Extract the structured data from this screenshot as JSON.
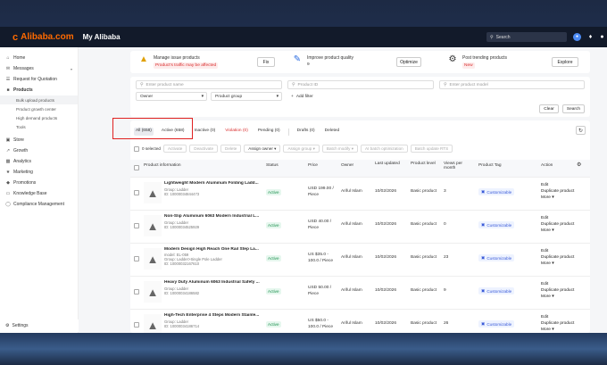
{
  "topbar": {
    "logo_text": "Alibaba.com",
    "section": "My Alibaba",
    "search_placeholder": "Search"
  },
  "sidebar": {
    "items": [
      {
        "label": "Home"
      },
      {
        "label": "Messages"
      },
      {
        "label": "Request for Quotation"
      },
      {
        "label": "Products"
      },
      {
        "label": "Store"
      },
      {
        "label": "Growth"
      },
      {
        "label": "Analytics"
      },
      {
        "label": "Marketing"
      },
      {
        "label": "Promotions"
      },
      {
        "label": "Knowledge Base"
      },
      {
        "label": "Compliance Management"
      }
    ],
    "products_sub": [
      "Bulk upload products",
      "Product growth center",
      "High demand products",
      "Tools"
    ],
    "settings": "Settings"
  },
  "tasks": [
    {
      "title": "Manage issue products",
      "sub": "Product's traffic may be affected",
      "button": "Fix"
    },
    {
      "title": "Improve product quality",
      "sub": "9",
      "button": "Optimize"
    },
    {
      "title": "Post trending products",
      "sub": "New",
      "button": "Explore"
    }
  ],
  "filters": {
    "product_name_placeholder": "Enter product name",
    "product_id_placeholder": "Product ID",
    "product_model_placeholder": "Enter product model",
    "owner": "Owner",
    "product_group": "Product group",
    "add_filter": "Add filter",
    "clear": "Clear",
    "search": "Search"
  },
  "tabs": [
    {
      "label": "All",
      "count": "(658)"
    },
    {
      "label": "Active",
      "count": "(658)"
    },
    {
      "label": "Inactive",
      "count": "(0)"
    },
    {
      "label": "Violation",
      "count": "(0)"
    },
    {
      "label": "Pending",
      "count": "(0)"
    },
    {
      "label": "Drafts",
      "count": "(0)"
    },
    {
      "label": "Deleted",
      "count": ""
    }
  ],
  "bulk": {
    "selected": "0 selected",
    "buttons": [
      "Activate",
      "Deactivate",
      "Delete",
      "Assign owner",
      "Assign group",
      "Batch modify",
      "AI batch optimization",
      "Batch update RTS"
    ]
  },
  "table": {
    "headers": [
      "Product information",
      "Status",
      "Price",
      "Owner",
      "Last updated",
      "Product level",
      "Views per month",
      "Product Tag",
      "Action"
    ],
    "rows": [
      {
        "name": "Lightweight Modern Aluminum Folding Ladd...",
        "meta1": "Group: Ladder",
        "meta2": "ID: 10000034844473",
        "status": "Active",
        "price1": "USD 199.00 /",
        "price2": "Piece",
        "owner": "Ariful Islam",
        "date": "10/02/2026",
        "level": "Basic product",
        "views": "3",
        "tag": "Customizable",
        "actions": [
          "Edit",
          "Duplicate product",
          "More"
        ]
      },
      {
        "name": "Non-Slip Aluminum 6063 Modern Industrial L...",
        "meta1": "Group: Ladder",
        "meta2": "ID: 10000034525929",
        "status": "Active",
        "price1": "USD 40.00 /",
        "price2": "Piece",
        "owner": "Ariful Islam",
        "date": "10/02/2026",
        "level": "Basic product",
        "views": "0",
        "tag": "Customizable",
        "actions": [
          "Edit",
          "Duplicate product",
          "More"
        ]
      },
      {
        "name": "Modern Design High Reach One Rail Step La...",
        "meta1": "model: EL-059",
        "meta2": "Group: Ladder>Single Pole Ladder",
        "meta3": "ID: 10000032167610",
        "status": "Active",
        "price1": "US $35.0 -",
        "price2": "100.0 / Piece",
        "owner": "Ariful Islam",
        "date": "10/02/2026",
        "level": "Basic product",
        "views": "23",
        "tag": "Customizable",
        "actions": [
          "Edit",
          "Duplicate product",
          "More"
        ]
      },
      {
        "name": "Heavy Duty Aluminum 6063 Industrial Safety ...",
        "meta1": "Group: Ladder",
        "meta2": "ID: 10000034186582",
        "status": "Active",
        "price1": "USD 50.00 /",
        "price2": "Piece",
        "owner": "Ariful Islam",
        "date": "10/02/2026",
        "level": "Basic product",
        "views": "9",
        "tag": "Customizable",
        "actions": [
          "Edit",
          "Duplicate product",
          "More"
        ]
      },
      {
        "name": "High-Tech Enterprise 4 Steps Modern Stainle...",
        "meta1": "Group: Ladder",
        "meta2": "ID: 10000034186714",
        "status": "Active",
        "price1": "US $50.0 -",
        "price2": "100.0 / Piece",
        "owner": "Ariful Islam",
        "date": "10/02/2026",
        "level": "Basic product",
        "views": "26",
        "tag": "Customizable",
        "actions": [
          "Edit",
          "Duplicate product",
          "More"
        ]
      }
    ]
  }
}
